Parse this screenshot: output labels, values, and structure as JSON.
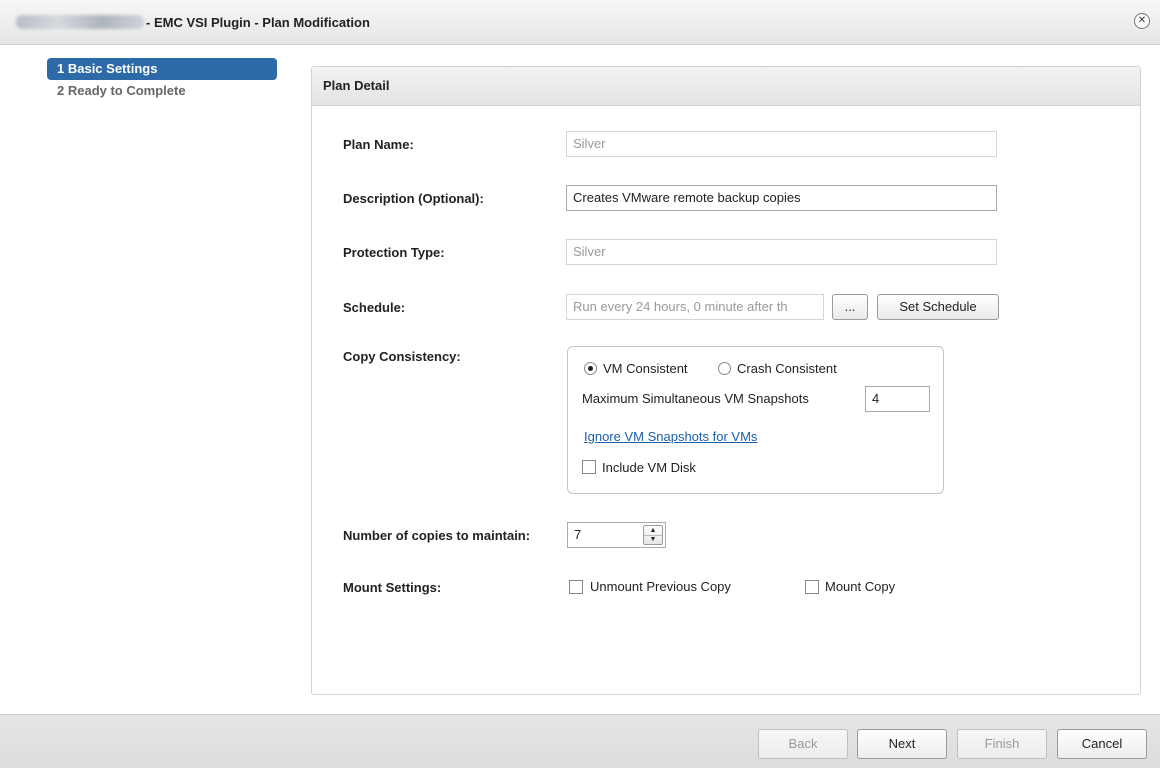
{
  "window": {
    "title": "- EMC VSI Plugin - Plan Modification"
  },
  "sidebar": {
    "steps": [
      {
        "label": "1  Basic Settings",
        "state": "active"
      },
      {
        "label": "2  Ready to Complete",
        "state": "inactive"
      }
    ]
  },
  "panel": {
    "title": "Plan Detail"
  },
  "form": {
    "plan_name": {
      "label": "Plan Name:",
      "value": "Silver"
    },
    "description": {
      "label": "Description (Optional):",
      "value": "Creates VMware remote backup copies"
    },
    "protection_type": {
      "label": "Protection Type:",
      "value": "Silver"
    },
    "schedule": {
      "label": "Schedule:",
      "value": "Run every 24 hours, 0 minute after th",
      "browse_label": "...",
      "set_label": "Set Schedule"
    },
    "copy_consistency": {
      "label": "Copy Consistency:",
      "vm_consistent": "VM Consistent",
      "crash_consistent": "Crash Consistent",
      "selected": "VM Consistent",
      "max_snapshots_label": "Maximum Simultaneous VM Snapshots",
      "max_snapshots_value": "4",
      "ignore_link": "Ignore VM Snapshots for VMs",
      "include_disk_label": "Include VM Disk",
      "include_disk_checked": false
    },
    "copies": {
      "label": "Number of copies to maintain:",
      "value": "7"
    },
    "mount": {
      "label": "Mount Settings:",
      "unmount_previous": "Unmount Previous Copy",
      "unmount_previous_checked": false,
      "mount_copy": "Mount Copy",
      "mount_copy_checked": false
    }
  },
  "footer": {
    "back": "Back",
    "next": "Next",
    "finish": "Finish",
    "cancel": "Cancel"
  },
  "icons": {
    "close": "close-icon",
    "spin_up": "up-arrow-icon",
    "spin_down": "down-arrow-icon"
  },
  "colors": {
    "accent": "#2e6aa8",
    "link": "#1a5fa8"
  }
}
